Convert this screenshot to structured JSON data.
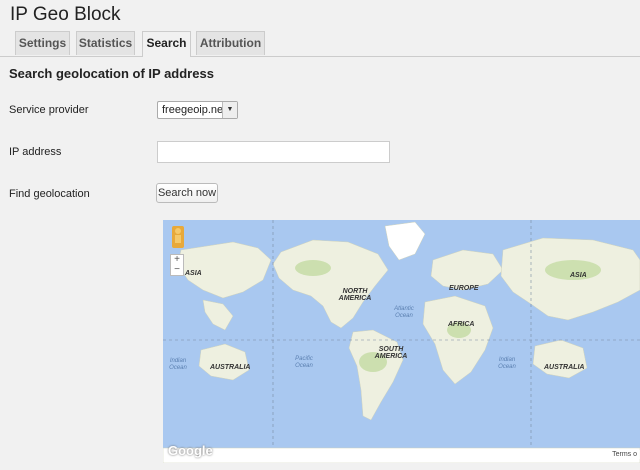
{
  "app": {
    "title": "IP Geo Block"
  },
  "tabs": [
    {
      "label": "Settings"
    },
    {
      "label": "Statistics"
    },
    {
      "label": "Search",
      "active": true
    },
    {
      "label": "Attribution"
    }
  ],
  "form": {
    "heading": "Search geolocation of IP address",
    "provider_label": "Service provider",
    "provider_value": "freegeoip.net",
    "ip_label": "IP address",
    "ip_value": "",
    "find_label": "Find geolocation",
    "search_button": "Search now"
  },
  "map": {
    "zoom_in": "+",
    "zoom_out": "−",
    "labels": {
      "asia_left": "ASIA",
      "north_america": "NORTH AMERICA",
      "europe": "EUROPE",
      "asia_right": "ASIA",
      "africa": "AFRICA",
      "south_america": "SOUTH AMERICA",
      "australia_left": "AUSTRALIA",
      "australia_right": "AUSTRALIA"
    },
    "oceans": {
      "atlantic": "Atlantic Ocean",
      "pacific": "Pacific Ocean",
      "indian_left": "Indian Ocean",
      "indian_right": "Indian Ocean"
    },
    "logo": "Google",
    "terms": "Terms o",
    "colors": {
      "water": "#a9c8f0",
      "land": "#eef0e0",
      "forest": "#c4dca4",
      "ice": "#ffffff"
    }
  }
}
